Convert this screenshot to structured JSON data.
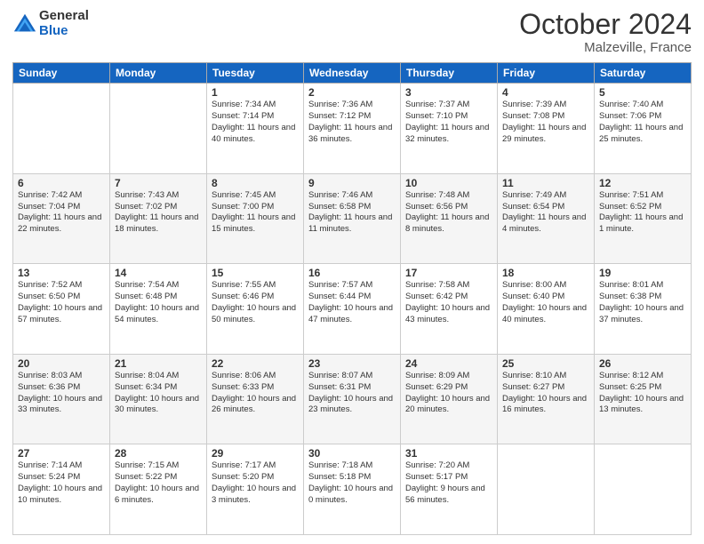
{
  "logo": {
    "general": "General",
    "blue": "Blue"
  },
  "title": {
    "month": "October 2024",
    "location": "Malzeville, France"
  },
  "headers": [
    "Sunday",
    "Monday",
    "Tuesday",
    "Wednesday",
    "Thursday",
    "Friday",
    "Saturday"
  ],
  "weeks": [
    [
      {
        "day": "",
        "sunrise": "",
        "sunset": "",
        "daylight": ""
      },
      {
        "day": "",
        "sunrise": "",
        "sunset": "",
        "daylight": ""
      },
      {
        "day": "1",
        "sunrise": "Sunrise: 7:34 AM",
        "sunset": "Sunset: 7:14 PM",
        "daylight": "Daylight: 11 hours and 40 minutes."
      },
      {
        "day": "2",
        "sunrise": "Sunrise: 7:36 AM",
        "sunset": "Sunset: 7:12 PM",
        "daylight": "Daylight: 11 hours and 36 minutes."
      },
      {
        "day": "3",
        "sunrise": "Sunrise: 7:37 AM",
        "sunset": "Sunset: 7:10 PM",
        "daylight": "Daylight: 11 hours and 32 minutes."
      },
      {
        "day": "4",
        "sunrise": "Sunrise: 7:39 AM",
        "sunset": "Sunset: 7:08 PM",
        "daylight": "Daylight: 11 hours and 29 minutes."
      },
      {
        "day": "5",
        "sunrise": "Sunrise: 7:40 AM",
        "sunset": "Sunset: 7:06 PM",
        "daylight": "Daylight: 11 hours and 25 minutes."
      }
    ],
    [
      {
        "day": "6",
        "sunrise": "Sunrise: 7:42 AM",
        "sunset": "Sunset: 7:04 PM",
        "daylight": "Daylight: 11 hours and 22 minutes."
      },
      {
        "day": "7",
        "sunrise": "Sunrise: 7:43 AM",
        "sunset": "Sunset: 7:02 PM",
        "daylight": "Daylight: 11 hours and 18 minutes."
      },
      {
        "day": "8",
        "sunrise": "Sunrise: 7:45 AM",
        "sunset": "Sunset: 7:00 PM",
        "daylight": "Daylight: 11 hours and 15 minutes."
      },
      {
        "day": "9",
        "sunrise": "Sunrise: 7:46 AM",
        "sunset": "Sunset: 6:58 PM",
        "daylight": "Daylight: 11 hours and 11 minutes."
      },
      {
        "day": "10",
        "sunrise": "Sunrise: 7:48 AM",
        "sunset": "Sunset: 6:56 PM",
        "daylight": "Daylight: 11 hours and 8 minutes."
      },
      {
        "day": "11",
        "sunrise": "Sunrise: 7:49 AM",
        "sunset": "Sunset: 6:54 PM",
        "daylight": "Daylight: 11 hours and 4 minutes."
      },
      {
        "day": "12",
        "sunrise": "Sunrise: 7:51 AM",
        "sunset": "Sunset: 6:52 PM",
        "daylight": "Daylight: 11 hours and 1 minute."
      }
    ],
    [
      {
        "day": "13",
        "sunrise": "Sunrise: 7:52 AM",
        "sunset": "Sunset: 6:50 PM",
        "daylight": "Daylight: 10 hours and 57 minutes."
      },
      {
        "day": "14",
        "sunrise": "Sunrise: 7:54 AM",
        "sunset": "Sunset: 6:48 PM",
        "daylight": "Daylight: 10 hours and 54 minutes."
      },
      {
        "day": "15",
        "sunrise": "Sunrise: 7:55 AM",
        "sunset": "Sunset: 6:46 PM",
        "daylight": "Daylight: 10 hours and 50 minutes."
      },
      {
        "day": "16",
        "sunrise": "Sunrise: 7:57 AM",
        "sunset": "Sunset: 6:44 PM",
        "daylight": "Daylight: 10 hours and 47 minutes."
      },
      {
        "day": "17",
        "sunrise": "Sunrise: 7:58 AM",
        "sunset": "Sunset: 6:42 PM",
        "daylight": "Daylight: 10 hours and 43 minutes."
      },
      {
        "day": "18",
        "sunrise": "Sunrise: 8:00 AM",
        "sunset": "Sunset: 6:40 PM",
        "daylight": "Daylight: 10 hours and 40 minutes."
      },
      {
        "day": "19",
        "sunrise": "Sunrise: 8:01 AM",
        "sunset": "Sunset: 6:38 PM",
        "daylight": "Daylight: 10 hours and 37 minutes."
      }
    ],
    [
      {
        "day": "20",
        "sunrise": "Sunrise: 8:03 AM",
        "sunset": "Sunset: 6:36 PM",
        "daylight": "Daylight: 10 hours and 33 minutes."
      },
      {
        "day": "21",
        "sunrise": "Sunrise: 8:04 AM",
        "sunset": "Sunset: 6:34 PM",
        "daylight": "Daylight: 10 hours and 30 minutes."
      },
      {
        "day": "22",
        "sunrise": "Sunrise: 8:06 AM",
        "sunset": "Sunset: 6:33 PM",
        "daylight": "Daylight: 10 hours and 26 minutes."
      },
      {
        "day": "23",
        "sunrise": "Sunrise: 8:07 AM",
        "sunset": "Sunset: 6:31 PM",
        "daylight": "Daylight: 10 hours and 23 minutes."
      },
      {
        "day": "24",
        "sunrise": "Sunrise: 8:09 AM",
        "sunset": "Sunset: 6:29 PM",
        "daylight": "Daylight: 10 hours and 20 minutes."
      },
      {
        "day": "25",
        "sunrise": "Sunrise: 8:10 AM",
        "sunset": "Sunset: 6:27 PM",
        "daylight": "Daylight: 10 hours and 16 minutes."
      },
      {
        "day": "26",
        "sunrise": "Sunrise: 8:12 AM",
        "sunset": "Sunset: 6:25 PM",
        "daylight": "Daylight: 10 hours and 13 minutes."
      }
    ],
    [
      {
        "day": "27",
        "sunrise": "Sunrise: 7:14 AM",
        "sunset": "Sunset: 5:24 PM",
        "daylight": "Daylight: 10 hours and 10 minutes."
      },
      {
        "day": "28",
        "sunrise": "Sunrise: 7:15 AM",
        "sunset": "Sunset: 5:22 PM",
        "daylight": "Daylight: 10 hours and 6 minutes."
      },
      {
        "day": "29",
        "sunrise": "Sunrise: 7:17 AM",
        "sunset": "Sunset: 5:20 PM",
        "daylight": "Daylight: 10 hours and 3 minutes."
      },
      {
        "day": "30",
        "sunrise": "Sunrise: 7:18 AM",
        "sunset": "Sunset: 5:18 PM",
        "daylight": "Daylight: 10 hours and 0 minutes."
      },
      {
        "day": "31",
        "sunrise": "Sunrise: 7:20 AM",
        "sunset": "Sunset: 5:17 PM",
        "daylight": "Daylight: 9 hours and 56 minutes."
      },
      {
        "day": "",
        "sunrise": "",
        "sunset": "",
        "daylight": ""
      },
      {
        "day": "",
        "sunrise": "",
        "sunset": "",
        "daylight": ""
      }
    ]
  ]
}
